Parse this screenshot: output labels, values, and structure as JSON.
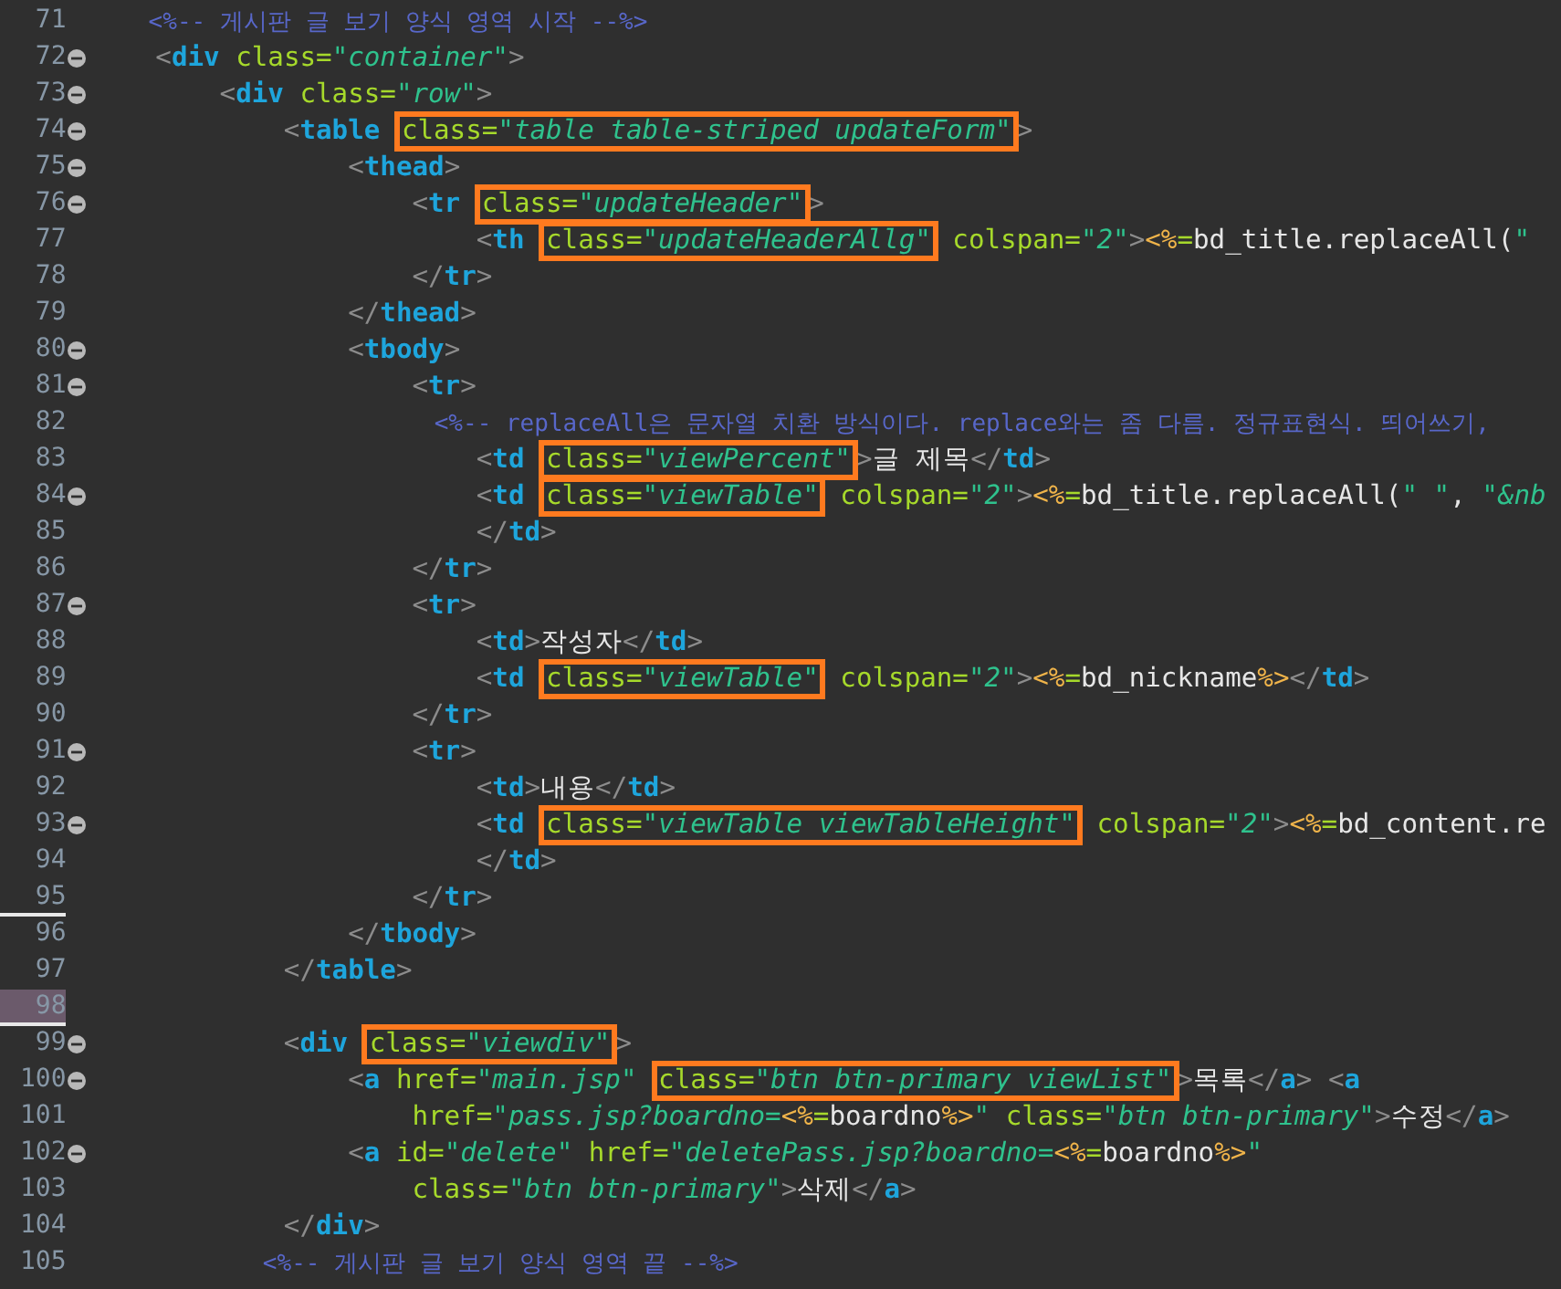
{
  "editor": {
    "lines": [
      {
        "number": "71",
        "foldable": false,
        "segments": [
          {
            "boxed": false,
            "tokens": [
              {
                "kind": "comment",
                "text": "    <%-- 게시판 글 보기 양식 영역 시작 --%>"
              }
            ]
          }
        ]
      },
      {
        "number": "72",
        "foldable": true,
        "segments": [
          {
            "boxed": false,
            "tokens": [
              {
                "kind": "punct",
                "text": "    <"
              },
              {
                "kind": "tag",
                "text": "div"
              },
              {
                "kind": "attr",
                "text": " class="
              },
              {
                "kind": "string",
                "text": "\"container\""
              },
              {
                "kind": "punct",
                "text": ">"
              }
            ]
          }
        ]
      },
      {
        "number": "73",
        "foldable": true,
        "segments": [
          {
            "boxed": false,
            "tokens": [
              {
                "kind": "punct",
                "text": "        <"
              },
              {
                "kind": "tag",
                "text": "div"
              },
              {
                "kind": "attr",
                "text": " class="
              },
              {
                "kind": "string",
                "text": "\"row\""
              },
              {
                "kind": "punct",
                "text": ">"
              }
            ]
          }
        ]
      },
      {
        "number": "74",
        "foldable": true,
        "segments": [
          {
            "boxed": false,
            "tokens": [
              {
                "kind": "punct",
                "text": "            <"
              },
              {
                "kind": "tag",
                "text": "table "
              }
            ]
          },
          {
            "boxed": true,
            "tokens": [
              {
                "kind": "attr",
                "text": "class="
              },
              {
                "kind": "string",
                "text": "\"table table-striped updateForm\""
              }
            ]
          },
          {
            "boxed": false,
            "tokens": [
              {
                "kind": "punct",
                "text": ">"
              }
            ]
          }
        ]
      },
      {
        "number": "75",
        "foldable": true,
        "segments": [
          {
            "boxed": false,
            "tokens": [
              {
                "kind": "punct",
                "text": "                <"
              },
              {
                "kind": "tag",
                "text": "thead"
              },
              {
                "kind": "punct",
                "text": ">"
              }
            ]
          }
        ]
      },
      {
        "number": "76",
        "foldable": true,
        "segments": [
          {
            "boxed": false,
            "tokens": [
              {
                "kind": "punct",
                "text": "                    <"
              },
              {
                "kind": "tag",
                "text": "tr "
              }
            ]
          },
          {
            "boxed": true,
            "tokens": [
              {
                "kind": "attr",
                "text": "class="
              },
              {
                "kind": "string",
                "text": "\"updateHeader\""
              }
            ]
          },
          {
            "boxed": false,
            "tokens": [
              {
                "kind": "punct",
                "text": ">"
              }
            ]
          }
        ]
      },
      {
        "number": "77",
        "foldable": false,
        "segments": [
          {
            "boxed": false,
            "tokens": [
              {
                "kind": "punct",
                "text": "                        <"
              },
              {
                "kind": "tag",
                "text": "th "
              }
            ]
          },
          {
            "boxed": true,
            "tokens": [
              {
                "kind": "attr",
                "text": "class="
              },
              {
                "kind": "string",
                "text": "\"updateHeaderAllg\""
              }
            ]
          },
          {
            "boxed": false,
            "tokens": [
              {
                "kind": "attr",
                "text": " colspan="
              },
              {
                "kind": "string",
                "text": "\"2\""
              },
              {
                "kind": "punct",
                "text": ">"
              },
              {
                "kind": "jsp",
                "text": "<%"
              },
              {
                "kind": "attr",
                "text": "="
              },
              {
                "kind": "plain",
                "text": "bd_title.replaceAll("
              },
              {
                "kind": "string",
                "text": "\""
              }
            ]
          }
        ]
      },
      {
        "number": "78",
        "foldable": false,
        "segments": [
          {
            "boxed": false,
            "tokens": [
              {
                "kind": "punct",
                "text": "                    </"
              },
              {
                "kind": "tag",
                "text": "tr"
              },
              {
                "kind": "punct",
                "text": ">"
              }
            ]
          }
        ]
      },
      {
        "number": "79",
        "foldable": false,
        "segments": [
          {
            "boxed": false,
            "tokens": [
              {
                "kind": "punct",
                "text": "                </"
              },
              {
                "kind": "tag",
                "text": "thead"
              },
              {
                "kind": "punct",
                "text": ">"
              }
            ]
          }
        ]
      },
      {
        "number": "80",
        "foldable": true,
        "segments": [
          {
            "boxed": false,
            "tokens": [
              {
                "kind": "punct",
                "text": "                <"
              },
              {
                "kind": "tag",
                "text": "tbody"
              },
              {
                "kind": "punct",
                "text": ">"
              }
            ]
          }
        ]
      },
      {
        "number": "81",
        "foldable": true,
        "segments": [
          {
            "boxed": false,
            "tokens": [
              {
                "kind": "punct",
                "text": "                    <"
              },
              {
                "kind": "tag",
                "text": "tr"
              },
              {
                "kind": "punct",
                "text": ">"
              }
            ]
          }
        ]
      },
      {
        "number": "82",
        "foldable": false,
        "segments": [
          {
            "boxed": false,
            "tokens": [
              {
                "kind": "comment",
                "text": "                        <%-- replaceAll은 문자열 치환 방식이다. replace와는 좀 다름. 정규표현식. 띄어쓰기,"
              }
            ]
          }
        ]
      },
      {
        "number": "83",
        "foldable": false,
        "segments": [
          {
            "boxed": false,
            "tokens": [
              {
                "kind": "punct",
                "text": "                        <"
              },
              {
                "kind": "tag",
                "text": "td "
              }
            ]
          },
          {
            "boxed": true,
            "tokens": [
              {
                "kind": "attr",
                "text": "class="
              },
              {
                "kind": "string",
                "text": "\"viewPercent\""
              }
            ]
          },
          {
            "boxed": false,
            "tokens": [
              {
                "kind": "punct",
                "text": ">"
              },
              {
                "kind": "plain",
                "text": "글 제목"
              },
              {
                "kind": "punct",
                "text": "</"
              },
              {
                "kind": "tag",
                "text": "td"
              },
              {
                "kind": "punct",
                "text": ">"
              }
            ]
          }
        ]
      },
      {
        "number": "84",
        "foldable": true,
        "segments": [
          {
            "boxed": false,
            "tokens": [
              {
                "kind": "punct",
                "text": "                        <"
              },
              {
                "kind": "tag",
                "text": "td "
              }
            ]
          },
          {
            "boxed": true,
            "tokens": [
              {
                "kind": "attr",
                "text": "class="
              },
              {
                "kind": "string",
                "text": "\"viewTable\""
              }
            ]
          },
          {
            "boxed": false,
            "tokens": [
              {
                "kind": "attr",
                "text": " colspan="
              },
              {
                "kind": "string",
                "text": "\"2\""
              },
              {
                "kind": "punct",
                "text": ">"
              },
              {
                "kind": "jsp",
                "text": "<%"
              },
              {
                "kind": "attr",
                "text": "="
              },
              {
                "kind": "plain",
                "text": "bd_title.replaceAll("
              },
              {
                "kind": "string",
                "text": "\" \""
              },
              {
                "kind": "plain",
                "text": ", "
              },
              {
                "kind": "string",
                "text": "\"&nb"
              }
            ]
          }
        ]
      },
      {
        "number": "85",
        "foldable": false,
        "segments": [
          {
            "boxed": false,
            "tokens": [
              {
                "kind": "punct",
                "text": "                        </"
              },
              {
                "kind": "tag",
                "text": "td"
              },
              {
                "kind": "punct",
                "text": ">"
              }
            ]
          }
        ]
      },
      {
        "number": "86",
        "foldable": false,
        "segments": [
          {
            "boxed": false,
            "tokens": [
              {
                "kind": "punct",
                "text": "                    </"
              },
              {
                "kind": "tag",
                "text": "tr"
              },
              {
                "kind": "punct",
                "text": ">"
              }
            ]
          }
        ]
      },
      {
        "number": "87",
        "foldable": true,
        "segments": [
          {
            "boxed": false,
            "tokens": [
              {
                "kind": "punct",
                "text": "                    <"
              },
              {
                "kind": "tag",
                "text": "tr"
              },
              {
                "kind": "punct",
                "text": ">"
              }
            ]
          }
        ]
      },
      {
        "number": "88",
        "foldable": false,
        "segments": [
          {
            "boxed": false,
            "tokens": [
              {
                "kind": "punct",
                "text": "                        <"
              },
              {
                "kind": "tag",
                "text": "td"
              },
              {
                "kind": "punct",
                "text": ">"
              },
              {
                "kind": "plain",
                "text": "작성자"
              },
              {
                "kind": "punct",
                "text": "</"
              },
              {
                "kind": "tag",
                "text": "td"
              },
              {
                "kind": "punct",
                "text": ">"
              }
            ]
          }
        ]
      },
      {
        "number": "89",
        "foldable": false,
        "segments": [
          {
            "boxed": false,
            "tokens": [
              {
                "kind": "punct",
                "text": "                        <"
              },
              {
                "kind": "tag",
                "text": "td "
              }
            ]
          },
          {
            "boxed": true,
            "tokens": [
              {
                "kind": "attr",
                "text": "class="
              },
              {
                "kind": "string",
                "text": "\"viewTable\""
              }
            ]
          },
          {
            "boxed": false,
            "tokens": [
              {
                "kind": "attr",
                "text": " colspan="
              },
              {
                "kind": "string",
                "text": "\"2\""
              },
              {
                "kind": "punct",
                "text": ">"
              },
              {
                "kind": "jsp",
                "text": "<%"
              },
              {
                "kind": "attr",
                "text": "="
              },
              {
                "kind": "plain",
                "text": "bd_nickname"
              },
              {
                "kind": "jsp",
                "text": "%>"
              },
              {
                "kind": "punct",
                "text": "</"
              },
              {
                "kind": "tag",
                "text": "td"
              },
              {
                "kind": "punct",
                "text": ">"
              }
            ]
          }
        ]
      },
      {
        "number": "90",
        "foldable": false,
        "segments": [
          {
            "boxed": false,
            "tokens": [
              {
                "kind": "punct",
                "text": "                    </"
              },
              {
                "kind": "tag",
                "text": "tr"
              },
              {
                "kind": "punct",
                "text": ">"
              }
            ]
          }
        ]
      },
      {
        "number": "91",
        "foldable": true,
        "segments": [
          {
            "boxed": false,
            "tokens": [
              {
                "kind": "punct",
                "text": "                    <"
              },
              {
                "kind": "tag",
                "text": "tr"
              },
              {
                "kind": "punct",
                "text": ">"
              }
            ]
          }
        ]
      },
      {
        "number": "92",
        "foldable": false,
        "segments": [
          {
            "boxed": false,
            "tokens": [
              {
                "kind": "punct",
                "text": "                        <"
              },
              {
                "kind": "tag",
                "text": "td"
              },
              {
                "kind": "punct",
                "text": ">"
              },
              {
                "kind": "plain",
                "text": "내용"
              },
              {
                "kind": "punct",
                "text": "</"
              },
              {
                "kind": "tag",
                "text": "td"
              },
              {
                "kind": "punct",
                "text": ">"
              }
            ]
          }
        ]
      },
      {
        "number": "93",
        "foldable": true,
        "segments": [
          {
            "boxed": false,
            "tokens": [
              {
                "kind": "punct",
                "text": "                        <"
              },
              {
                "kind": "tag",
                "text": "td "
              }
            ]
          },
          {
            "boxed": true,
            "tokens": [
              {
                "kind": "attr",
                "text": "class="
              },
              {
                "kind": "string",
                "text": "\"viewTable viewTableHeight\""
              }
            ]
          },
          {
            "boxed": false,
            "tokens": [
              {
                "kind": "attr",
                "text": " colspan="
              },
              {
                "kind": "string",
                "text": "\"2\""
              },
              {
                "kind": "punct",
                "text": ">"
              },
              {
                "kind": "jsp",
                "text": "<%"
              },
              {
                "kind": "attr",
                "text": "="
              },
              {
                "kind": "plain",
                "text": "bd_content.re"
              }
            ]
          }
        ]
      },
      {
        "number": "94",
        "foldable": false,
        "segments": [
          {
            "boxed": false,
            "tokens": [
              {
                "kind": "punct",
                "text": "                        </"
              },
              {
                "kind": "tag",
                "text": "td"
              },
              {
                "kind": "punct",
                "text": ">"
              }
            ]
          }
        ]
      },
      {
        "number": "95",
        "foldable": false,
        "marked": true,
        "segments": [
          {
            "boxed": false,
            "tokens": [
              {
                "kind": "punct",
                "text": "                    </"
              },
              {
                "kind": "tag",
                "text": "tr"
              },
              {
                "kind": "punct",
                "text": ">"
              }
            ]
          }
        ]
      },
      {
        "number": "96",
        "foldable": false,
        "segments": [
          {
            "boxed": false,
            "tokens": [
              {
                "kind": "punct",
                "text": "                </"
              },
              {
                "kind": "tag",
                "text": "tbody"
              },
              {
                "kind": "punct",
                "text": ">"
              }
            ]
          }
        ]
      },
      {
        "number": "97",
        "foldable": false,
        "segments": [
          {
            "boxed": false,
            "tokens": [
              {
                "kind": "punct",
                "text": "            </"
              },
              {
                "kind": "tag",
                "text": "table"
              },
              {
                "kind": "punct",
                "text": ">"
              }
            ]
          }
        ]
      },
      {
        "number": "98",
        "foldable": false,
        "marked": true,
        "current": true
      },
      {
        "number": "99",
        "foldable": true,
        "segments": [
          {
            "boxed": false,
            "tokens": [
              {
                "kind": "punct",
                "text": "            <"
              },
              {
                "kind": "tag",
                "text": "div "
              }
            ]
          },
          {
            "boxed": true,
            "tokens": [
              {
                "kind": "attr",
                "text": "class="
              },
              {
                "kind": "string",
                "text": "\"viewdiv\""
              }
            ]
          },
          {
            "boxed": false,
            "tokens": [
              {
                "kind": "punct",
                "text": ">"
              }
            ]
          }
        ]
      },
      {
        "number": "100",
        "foldable": true,
        "segments": [
          {
            "boxed": false,
            "tokens": [
              {
                "kind": "punct",
                "text": "                <"
              },
              {
                "kind": "tag",
                "text": "a"
              },
              {
                "kind": "attr",
                "text": " href="
              },
              {
                "kind": "string",
                "text": "\"main.jsp\" "
              }
            ]
          },
          {
            "boxed": true,
            "tokens": [
              {
                "kind": "attr",
                "text": "class="
              },
              {
                "kind": "string",
                "text": "\"btn btn-primary viewList\""
              }
            ]
          },
          {
            "boxed": false,
            "tokens": [
              {
                "kind": "punct",
                "text": ">"
              },
              {
                "kind": "plain",
                "text": "목록"
              },
              {
                "kind": "punct",
                "text": "</"
              },
              {
                "kind": "tag",
                "text": "a"
              },
              {
                "kind": "punct",
                "text": "> <"
              },
              {
                "kind": "tag",
                "text": "a"
              }
            ]
          }
        ]
      },
      {
        "number": "101",
        "foldable": false,
        "segments": [
          {
            "boxed": false,
            "tokens": [
              {
                "kind": "attr",
                "text": "                    href="
              },
              {
                "kind": "string",
                "text": "\"pass.jsp?boardno="
              },
              {
                "kind": "jsp",
                "text": "<%"
              },
              {
                "kind": "attr",
                "text": "="
              },
              {
                "kind": "plain",
                "text": "boardno"
              },
              {
                "kind": "jsp",
                "text": "%>"
              },
              {
                "kind": "string",
                "text": "\""
              },
              {
                "kind": "attr",
                "text": " class="
              },
              {
                "kind": "string",
                "text": "\"btn btn-primary\""
              },
              {
                "kind": "punct",
                "text": ">"
              },
              {
                "kind": "plain",
                "text": "수정"
              },
              {
                "kind": "punct",
                "text": "</"
              },
              {
                "kind": "tag",
                "text": "a"
              },
              {
                "kind": "punct",
                "text": ">"
              }
            ]
          }
        ]
      },
      {
        "number": "102",
        "foldable": true,
        "segments": [
          {
            "boxed": false,
            "tokens": [
              {
                "kind": "punct",
                "text": "                <"
              },
              {
                "kind": "tag",
                "text": "a"
              },
              {
                "kind": "attr",
                "text": " id="
              },
              {
                "kind": "string",
                "text": "\"delete\""
              },
              {
                "kind": "attr",
                "text": " href="
              },
              {
                "kind": "string",
                "text": "\"deletePass.jsp?boardno="
              },
              {
                "kind": "jsp",
                "text": "<%"
              },
              {
                "kind": "attr",
                "text": "="
              },
              {
                "kind": "plain",
                "text": "boardno"
              },
              {
                "kind": "jsp",
                "text": "%>"
              },
              {
                "kind": "string",
                "text": "\""
              }
            ]
          }
        ]
      },
      {
        "number": "103",
        "foldable": false,
        "segments": [
          {
            "boxed": false,
            "tokens": [
              {
                "kind": "attr",
                "text": "                    class="
              },
              {
                "kind": "string",
                "text": "\"btn btn-primary\""
              },
              {
                "kind": "punct",
                "text": ">"
              },
              {
                "kind": "plain",
                "text": "삭제"
              },
              {
                "kind": "punct",
                "text": "</"
              },
              {
                "kind": "tag",
                "text": "a"
              },
              {
                "kind": "punct",
                "text": ">"
              }
            ]
          }
        ]
      },
      {
        "number": "104",
        "foldable": false,
        "segments": [
          {
            "boxed": false,
            "tokens": [
              {
                "kind": "punct",
                "text": "            </"
              },
              {
                "kind": "tag",
                "text": "div"
              },
              {
                "kind": "punct",
                "text": ">"
              }
            ]
          }
        ]
      },
      {
        "number": "105",
        "foldable": false,
        "segments": [
          {
            "boxed": false,
            "tokens": [
              {
                "kind": "comment",
                "text": "            <%-- 게시판 글 보기 양식 영역 끝 --%>"
              }
            ]
          }
        ]
      }
    ]
  }
}
